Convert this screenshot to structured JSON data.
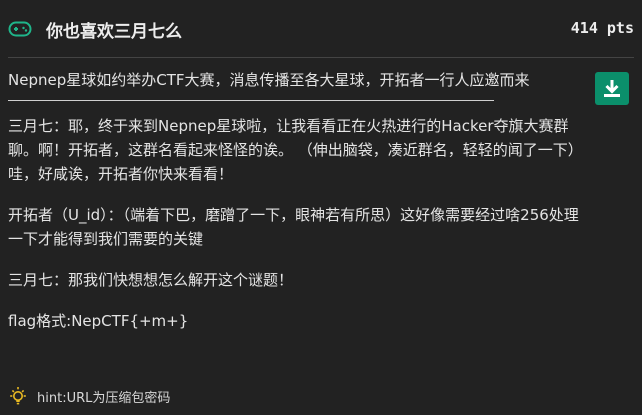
{
  "header": {
    "icon": "gamepad-icon",
    "title": "你也喜欢三月七么",
    "points": "414 pts"
  },
  "download": {
    "icon": "download-icon",
    "accent_color": "#0b8f6b"
  },
  "description": {
    "intro": "Nepnep星球如约举办CTF大赛，消息传播至各大星球，开拓者一行人应邀而来",
    "paragraphs": [
      "三月七：耶，终于来到Nepnep星球啦，让我看看正在火热进行的Hacker夺旗大赛群聊。啊！开拓者，这群名看起来怪怪的诶。 （伸出脑袋，凑近群名，轻轻的闻了一下）哇，好咸诶，开拓者你快来看看！",
      "开拓者（U_id）：（端着下巴，磨蹭了一下，眼神若有所思）这好像需要经过啥256处理一下才能得到我们需要的关键",
      "三月七：那我们快想想怎么解开这个谜题！",
      "flag格式:NepCTF{+m+}"
    ]
  },
  "hint": {
    "icon": "lightbulb-icon",
    "text": "hint:URL为压缩包密码",
    "icon_color": "#e8b923"
  }
}
